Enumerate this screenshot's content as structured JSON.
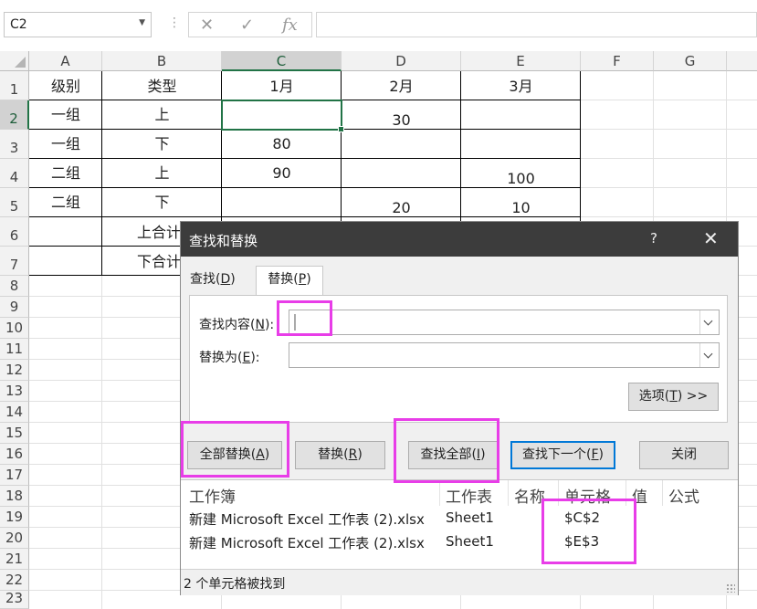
{
  "formula_bar": {
    "name_box": "C2",
    "separator": "⋮",
    "cancel_icon": "✕",
    "enter_icon": "✓",
    "fx_label": "fx",
    "formula": ""
  },
  "sheet": {
    "columns": [
      "A",
      "B",
      "C",
      "D",
      "E",
      "F",
      "G"
    ],
    "rows": [
      "1",
      "2",
      "3",
      "4",
      "5",
      "6",
      "7",
      "8",
      "9",
      "10",
      "11",
      "12",
      "13",
      "14",
      "15",
      "16",
      "17",
      "18",
      "19",
      "20",
      "21",
      "22",
      "23"
    ],
    "selected_cell": "C2",
    "cells": {
      "A1": "级别",
      "B1": "类型",
      "C1": "1月",
      "D1": "2月",
      "E1": "3月",
      "A2": "一组",
      "B2": "上",
      "D2": "30",
      "A3": "一组",
      "B3": "下",
      "C3": "80",
      "A4": "二组",
      "B4": "上",
      "C4": "90",
      "E4": "100",
      "A5": "二组",
      "B5": "下",
      "D5": "20",
      "E5": "10",
      "B6": "上合计",
      "B7": "下合计"
    }
  },
  "dialog": {
    "title": "查找和替换",
    "help": "?",
    "close": "✕",
    "tabs": {
      "find": {
        "text": "查找(",
        "key": "D",
        "end": ")"
      },
      "replace": {
        "text": "替换(",
        "key": "P",
        "end": ")"
      }
    },
    "find_label": {
      "text": "查找内容(",
      "key": "N",
      "end": "):"
    },
    "find_value": "",
    "replace_label": {
      "text": "替换为(",
      "key": "E",
      "end": "):"
    },
    "replace_value": "",
    "options_button": {
      "text": "选项(",
      "key": "T",
      "end": ") >>"
    },
    "buttons": {
      "replace_all": {
        "text": "全部替换(",
        "key": "A",
        "end": ")"
      },
      "replace": {
        "text": "替换(",
        "key": "R",
        "end": ")"
      },
      "find_all": {
        "text": "查找全部(",
        "key": "I",
        "end": ")"
      },
      "find_next": {
        "text": "查找下一个(",
        "key": "F",
        "end": ")"
      },
      "close": "关闭"
    },
    "results": {
      "headers": [
        "工作簿",
        "工作表",
        "名称",
        "单元格",
        "值",
        "公式"
      ],
      "rows": [
        {
          "workbook": "新建 Microsoft Excel 工作表 (2).xlsx",
          "sheet": "Sheet1",
          "name": "",
          "cell": "$C$2",
          "value": "",
          "formula": ""
        },
        {
          "workbook": "新建 Microsoft Excel 工作表 (2).xlsx",
          "sheet": "Sheet1",
          "name": "",
          "cell": "$E$3",
          "value": "",
          "formula": ""
        }
      ]
    },
    "status": "2 个单元格被找到"
  },
  "colors": {
    "excel_green": "#217346",
    "highlight": "#e83de8",
    "titlebar": "#3c3c3c",
    "focus_blue": "#0078d7"
  }
}
